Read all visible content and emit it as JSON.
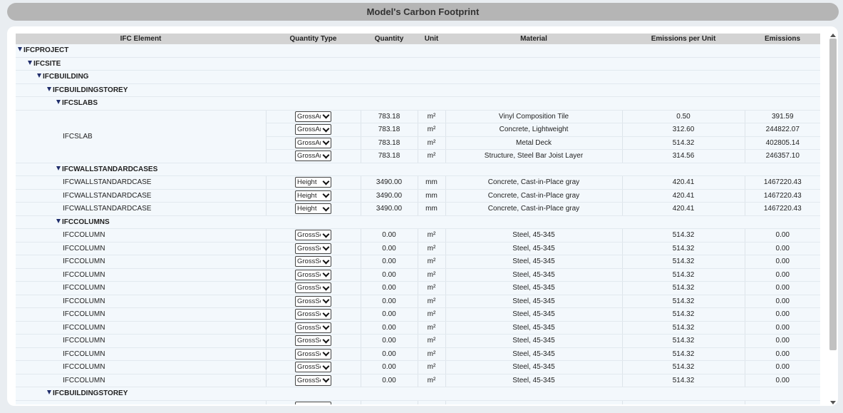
{
  "title": "Model's Carbon Footprint",
  "columns": [
    "IFC Element",
    "Quantity Type",
    "Quantity",
    "Unit",
    "Material",
    "Emissions per Unit",
    "Emissions"
  ],
  "groups": {
    "project": "IFCPROJECT",
    "site": "IFCSITE",
    "building": "IFCBUILDING",
    "storey": "IFCBUILDINGSTOREY",
    "slabs": "IFCSLABS",
    "walls": "IFCWALLSTANDARDCASES",
    "columns": "IFCCOLUMNS",
    "storey2": "IFCBUILDINGSTOREY"
  },
  "slab": {
    "element": "IFCSLAB",
    "rows": [
      {
        "qtype": "GrossArea",
        "quantity": "783.18",
        "unit": "m²",
        "material": "Vinyl Composition Tile",
        "epu": "0.50",
        "emissions": "391.59"
      },
      {
        "qtype": "GrossArea",
        "quantity": "783.18",
        "unit": "m²",
        "material": "Concrete, Lightweight",
        "epu": "312.60",
        "emissions": "244822.07"
      },
      {
        "qtype": "GrossArea",
        "quantity": "783.18",
        "unit": "m²",
        "material": "Metal Deck",
        "epu": "514.32",
        "emissions": "402805.14"
      },
      {
        "qtype": "GrossArea",
        "quantity": "783.18",
        "unit": "m²",
        "material": "Structure, Steel Bar Joist Layer",
        "epu": "314.56",
        "emissions": "246357.10"
      }
    ]
  },
  "walls": [
    {
      "element": "IFCWALLSTANDARDCASE",
      "qtype": "Height",
      "quantity": "3490.00",
      "unit": "mm",
      "material": "Concrete, Cast-in-Place gray",
      "epu": "420.41",
      "emissions": "1467220.43"
    },
    {
      "element": "IFCWALLSTANDARDCASE",
      "qtype": "Height",
      "quantity": "3490.00",
      "unit": "mm",
      "material": "Concrete, Cast-in-Place gray",
      "epu": "420.41",
      "emissions": "1467220.43"
    },
    {
      "element": "IFCWALLSTANDARDCASE",
      "qtype": "Height",
      "quantity": "3490.00",
      "unit": "mm",
      "material": "Concrete, Cast-in-Place gray",
      "epu": "420.41",
      "emissions": "1467220.43"
    }
  ],
  "columnsRows": [
    {
      "element": "IFCCOLUMN",
      "qtype": "GrossSectionArea",
      "quantity": "0.00",
      "unit": "m²",
      "material": "Steel, 45-345",
      "epu": "514.32",
      "emissions": "0.00"
    },
    {
      "element": "IFCCOLUMN",
      "qtype": "GrossSectionArea",
      "quantity": "0.00",
      "unit": "m²",
      "material": "Steel, 45-345",
      "epu": "514.32",
      "emissions": "0.00"
    },
    {
      "element": "IFCCOLUMN",
      "qtype": "GrossSectionArea",
      "quantity": "0.00",
      "unit": "m²",
      "material": "Steel, 45-345",
      "epu": "514.32",
      "emissions": "0.00"
    },
    {
      "element": "IFCCOLUMN",
      "qtype": "GrossSectionArea",
      "quantity": "0.00",
      "unit": "m²",
      "material": "Steel, 45-345",
      "epu": "514.32",
      "emissions": "0.00"
    },
    {
      "element": "IFCCOLUMN",
      "qtype": "GrossSectionArea",
      "quantity": "0.00",
      "unit": "m²",
      "material": "Steel, 45-345",
      "epu": "514.32",
      "emissions": "0.00"
    },
    {
      "element": "IFCCOLUMN",
      "qtype": "GrossSectionArea",
      "quantity": "0.00",
      "unit": "m²",
      "material": "Steel, 45-345",
      "epu": "514.32",
      "emissions": "0.00"
    },
    {
      "element": "IFCCOLUMN",
      "qtype": "GrossSectionArea",
      "quantity": "0.00",
      "unit": "m²",
      "material": "Steel, 45-345",
      "epu": "514.32",
      "emissions": "0.00"
    },
    {
      "element": "IFCCOLUMN",
      "qtype": "GrossSectionArea",
      "quantity": "0.00",
      "unit": "m²",
      "material": "Steel, 45-345",
      "epu": "514.32",
      "emissions": "0.00"
    },
    {
      "element": "IFCCOLUMN",
      "qtype": "GrossSectionArea",
      "quantity": "0.00",
      "unit": "m²",
      "material": "Steel, 45-345",
      "epu": "514.32",
      "emissions": "0.00"
    },
    {
      "element": "IFCCOLUMN",
      "qtype": "GrossSectionArea",
      "quantity": "0.00",
      "unit": "m²",
      "material": "Steel, 45-345",
      "epu": "514.32",
      "emissions": "0.00"
    },
    {
      "element": "IFCCOLUMN",
      "qtype": "GrossSectionArea",
      "quantity": "0.00",
      "unit": "m²",
      "material": "Steel, 45-345",
      "epu": "514.32",
      "emissions": "0.00"
    },
    {
      "element": "IFCCOLUMN",
      "qtype": "GrossSectionArea",
      "quantity": "0.00",
      "unit": "m²",
      "material": "Steel, 45-345",
      "epu": "514.32",
      "emissions": "0.00"
    }
  ]
}
